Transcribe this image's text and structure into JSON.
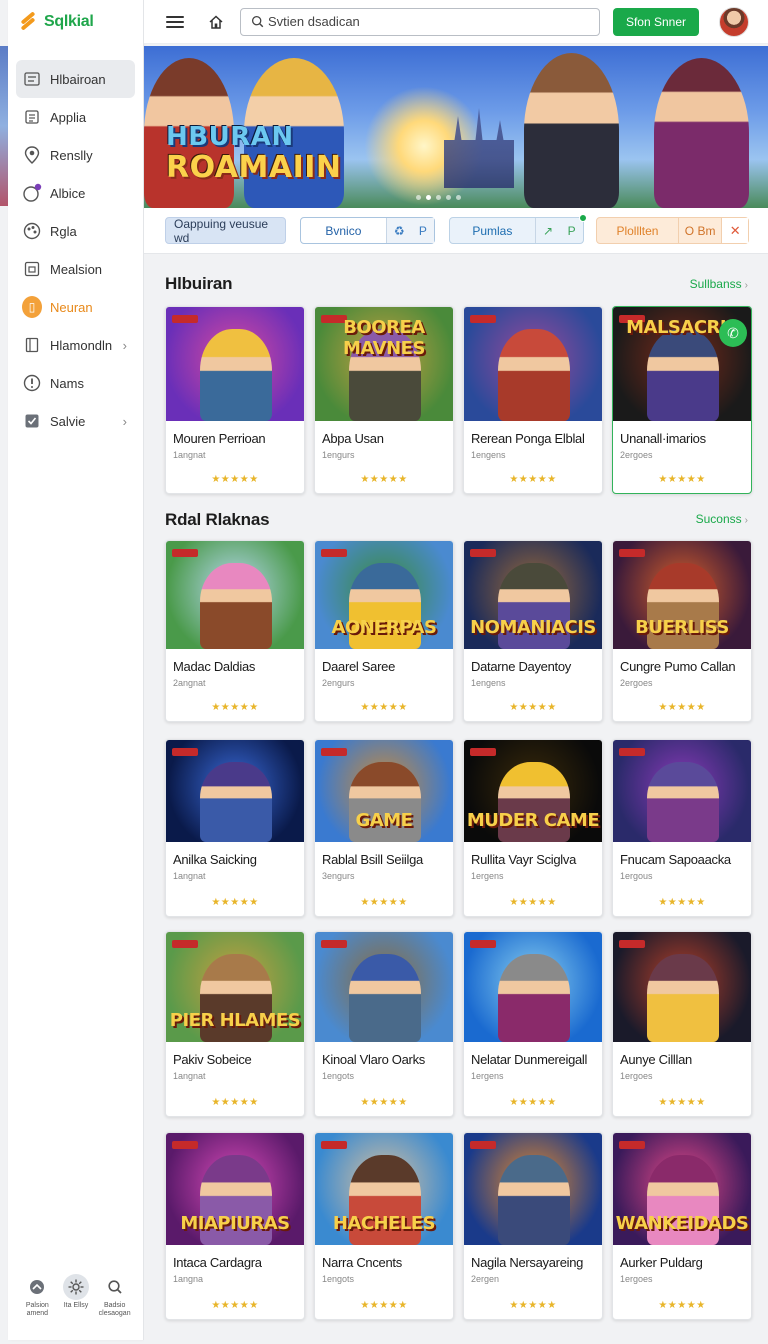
{
  "brand": {
    "name": "Sqlkial"
  },
  "sidebar": {
    "items": [
      {
        "label": "Hlbairoan",
        "icon": "list-icon",
        "active": true
      },
      {
        "label": "Applia",
        "icon": "document-icon"
      },
      {
        "label": "Renslly",
        "icon": "location-pin-icon"
      },
      {
        "label": "Albice",
        "icon": "heart-badge-icon"
      },
      {
        "label": "Rgla",
        "icon": "palette-icon"
      },
      {
        "label": "Mealsion",
        "icon": "frame-icon"
      },
      {
        "label": "Neuran",
        "icon": "orange-badge-icon",
        "accent": true
      },
      {
        "label": "Hlamondln",
        "icon": "bookmark-icon",
        "chevron": true
      },
      {
        "label": "Nams",
        "icon": "alert-icon"
      },
      {
        "label": "Salvie",
        "icon": "checkbox-icon",
        "chevron": true
      }
    ],
    "footer": [
      {
        "label": "Palsion amend",
        "icon": "puzzle-icon"
      },
      {
        "label": "Ita Ellsy",
        "icon": "settings-gear-icon",
        "selected": true
      },
      {
        "label": "Badsio clesaogan",
        "icon": "search-icon"
      }
    ]
  },
  "topbar": {
    "search_placeholder": "Svtien dsadican",
    "signin_label": "Sfon Snner"
  },
  "hero": {
    "title_line1": "HBURAN",
    "title_line2": "ROAMAIIN",
    "slide_count": 5,
    "active_slide": 1
  },
  "filters": {
    "chip1": "Oappuing veusue wd",
    "chip2": "Bvnico",
    "chip2_action": "P",
    "chip3": "Pumlas",
    "chip3_action": "P",
    "chip4": "Plolllten",
    "chip4_action": "O Bm",
    "close": "✕"
  },
  "sections": [
    {
      "title": "Hlbuiran",
      "link": "Sullbanss",
      "cards": [
        {
          "title": "Mouren Perrioan",
          "sub": "1angnat",
          "rating": "★★★★★"
        },
        {
          "title": "Abpa Usan",
          "sub": "1engurs",
          "rating": "★★★★★"
        },
        {
          "title": "Rerean Ponga Elblal",
          "sub": "1engens",
          "rating": "★★★★★"
        },
        {
          "title": "Unanall·imarios",
          "sub": "2ergoes",
          "rating": "★★★★★"
        }
      ]
    },
    {
      "title": "Rdal Rlaknas",
      "link": "Suconss",
      "cards": [
        {
          "title": "Madac Daldias",
          "sub": "2angnat",
          "rating": "★★★★★"
        },
        {
          "title": "Daarel Saree",
          "sub": "2engurs",
          "rating": "★★★★★"
        },
        {
          "title": "Datarne Dayentoy",
          "sub": "1engens",
          "rating": "★★★★★"
        },
        {
          "title": "Cungre Pumo Callan",
          "sub": "2ergoes",
          "rating": "★★★★★"
        },
        {
          "title": "Anilka Saicking",
          "sub": "1angnat",
          "rating": "★★★★★"
        },
        {
          "title": "Rablal Bsill Seiilga",
          "sub": "3engurs",
          "rating": "★★★★★"
        },
        {
          "title": "Rullita Vayr Sciglva",
          "sub": "1ergens",
          "rating": "★★★★★"
        },
        {
          "title": "Fnucam Sapoaacka",
          "sub": "1ergous",
          "rating": "★★★★★"
        },
        {
          "title": "Pakiv Sobeice",
          "sub": "1angnat",
          "rating": "★★★★★"
        },
        {
          "title": "Kinoal Vlaro Oarks",
          "sub": "1engots",
          "rating": "★★★★★"
        },
        {
          "title": "Nelatar Dunmereigall",
          "sub": "1ergens",
          "rating": "★★★★★"
        },
        {
          "title": "Aunye Cilllan",
          "sub": "1ergoes",
          "rating": "★★★★★"
        },
        {
          "title": "Intaca Cardagra",
          "sub": "1angna",
          "rating": "★★★★★"
        },
        {
          "title": "Narra Cncents",
          "sub": "1engots",
          "rating": "★★★★★"
        },
        {
          "title": "Nagila Nersayareing",
          "sub": "2ergen",
          "rating": "★★★★★"
        },
        {
          "title": "Aurker Puldarg",
          "sub": "1ergoes",
          "rating": "★★★★★"
        }
      ]
    }
  ],
  "thumb_texts": {
    "s0c1": "BOOREA MAVNES",
    "s0c3": "MALSACRIE",
    "s1c1": "AONERPAS",
    "s1c2": "NOMANIACIS",
    "s1c3": "BUERLISS",
    "s1c5": "GAME",
    "s1c6": "MUDER CAME",
    "s1c8": "PIER HLAMES",
    "s1c12": "MIAPIURAS",
    "s1c13": "HACHELES",
    "s1c15": "WANKEIDADS"
  },
  "colors": {
    "accent_green": "#1aa94a",
    "accent_orange": "#e8891a",
    "star": "#e8b52a"
  }
}
